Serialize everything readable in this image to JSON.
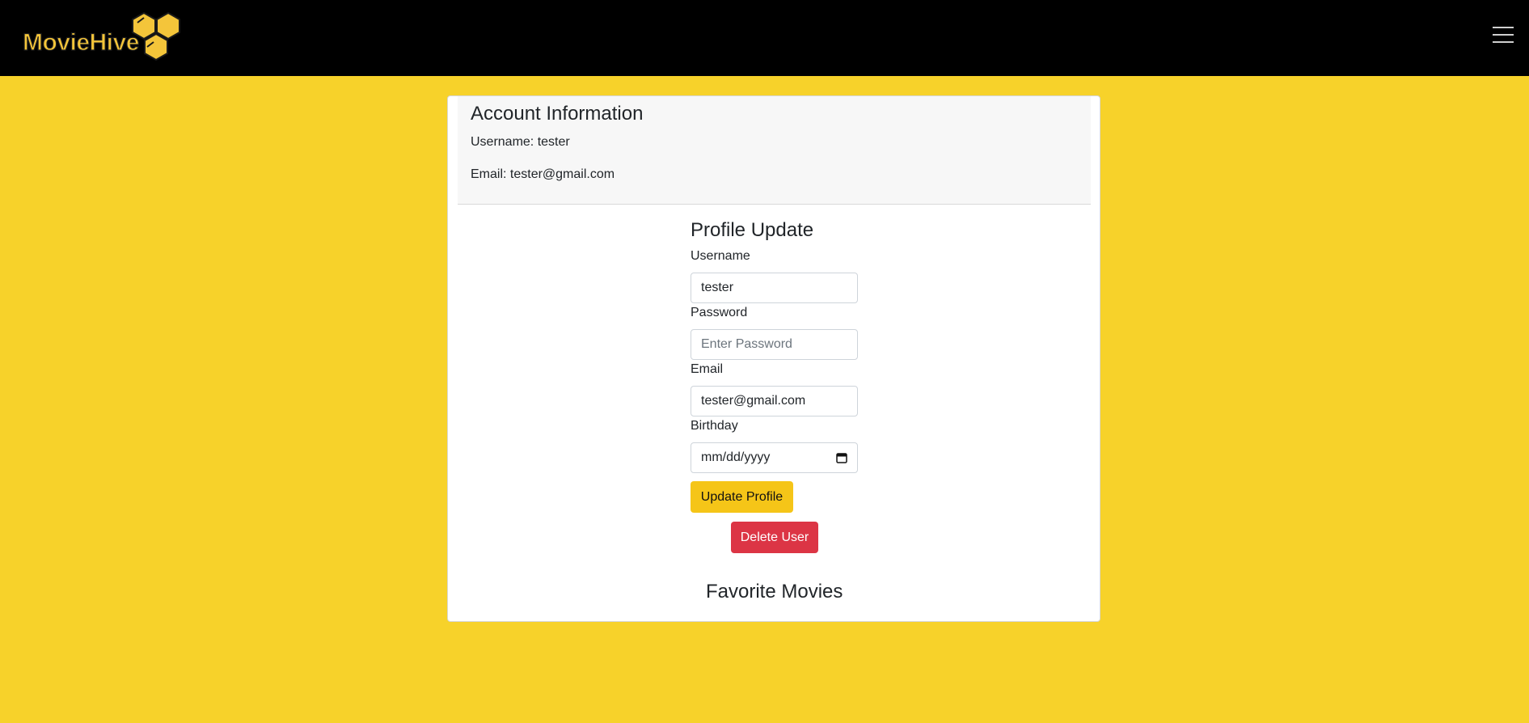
{
  "navbar": {
    "brand": "MovieHive",
    "menu_icon": "hamburger-menu-icon",
    "background": "#000000",
    "brand_color": "#f4c53a"
  },
  "page": {
    "background": "#f7d22a"
  },
  "account": {
    "title": "Account Information",
    "username_line": "Username: tester",
    "email_line": "Email: tester@gmail.com"
  },
  "profile_update": {
    "title": "Profile Update",
    "username_label": "Username",
    "username_value": "tester",
    "password_label": "Password",
    "password_placeholder": "Enter Password",
    "email_label": "Email",
    "email_value": "tester@gmail.com",
    "birthday_label": "Birthday",
    "birthday_placeholder": "mm/dd/yyyy",
    "calendar_icon": "calendar-icon",
    "update_button": "Update Profile",
    "update_color": "#f5c518",
    "delete_button": "Delete User",
    "delete_color": "#dc3545"
  },
  "favorites": {
    "title": "Favorite Movies"
  }
}
